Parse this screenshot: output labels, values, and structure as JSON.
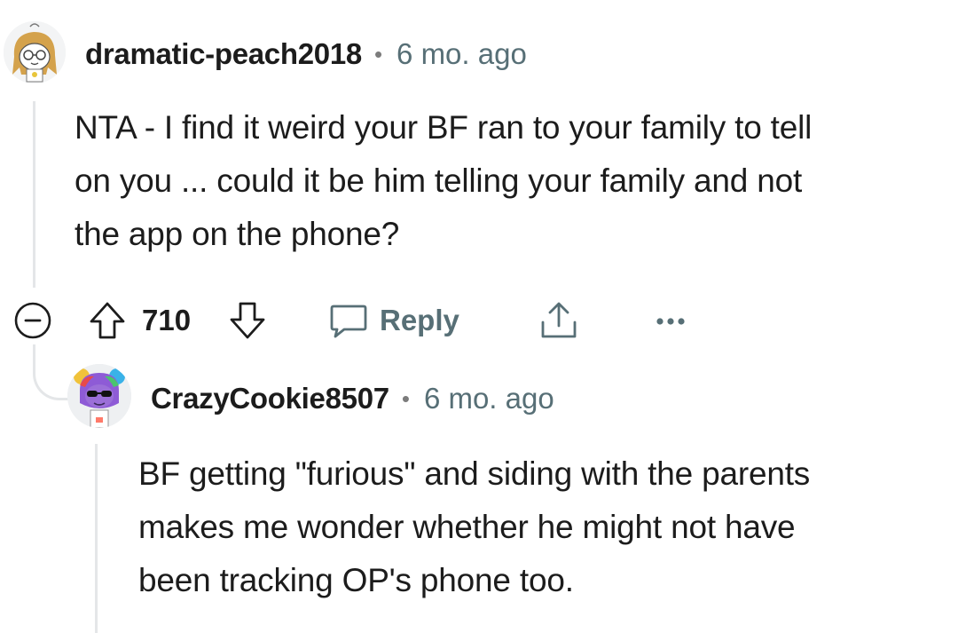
{
  "colors": {
    "text": "#1c1c1c",
    "meta": "#576f76",
    "icon": "#576f76",
    "thread_line": "#e4e6e8"
  },
  "comments": [
    {
      "username": "dramatic-peach2018",
      "separator": "•",
      "time": "6 mo. ago",
      "avatar_icon": "snoo-avatar-peach",
      "body": "NTA - I find it weird your BF ran to your family to tell on you ... could it be him telling your family and not the app on the phone?",
      "body_lines": [
        "NTA - I find it weird your BF ran to your family to tell",
        "on you ... could it be him telling your family and not",
        "the app on the phone?"
      ],
      "actions": {
        "collapse_icon": "collapse-minus-icon",
        "upvote_icon": "upvote-arrow-icon",
        "vote_count": "710",
        "downvote_icon": "downvote-arrow-icon",
        "reply_icon": "comment-bubble-icon",
        "reply_label": "Reply",
        "share_icon": "share-icon",
        "more_icon": "more-dots-icon"
      }
    },
    {
      "username": "CrazyCookie8507",
      "separator": "•",
      "time": "6 mo. ago",
      "avatar_icon": "snoo-avatar-rainbow",
      "body_lines": [
        "BF getting \"furious\" and siding with the parents",
        "makes me wonder whether he might not have",
        "been tracking OP's phone too."
      ]
    }
  ]
}
